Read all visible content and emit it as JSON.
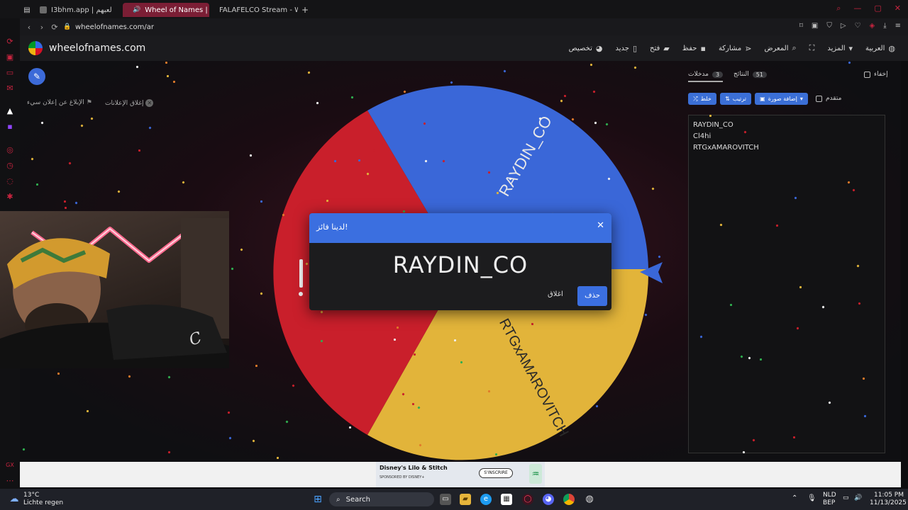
{
  "browser": {
    "tabs": [
      {
        "label": "I3bhm.app | لعبهم",
        "color": "#6b6b6b",
        "active": false
      },
      {
        "label": "Wheel of Names | عجلة",
        "color": "#e23b3b",
        "active": true
      },
      {
        "label": "FALAFELCO Stream - Wa",
        "color": "#53fc18",
        "active": false
      }
    ],
    "new_tab": "+",
    "url": "wheelofnames.com/ar"
  },
  "site": {
    "name": "wheelofnames.com",
    "menu": [
      {
        "label": "تخصيص",
        "icon": "palette-icon"
      },
      {
        "label": "جديد",
        "icon": "file-icon"
      },
      {
        "label": "فتح",
        "icon": "folder-icon"
      },
      {
        "label": "حفظ",
        "icon": "save-icon"
      },
      {
        "label": "مشاركة",
        "icon": "share-icon"
      },
      {
        "label": "المعرض",
        "icon": "search-icon"
      },
      {
        "label": "",
        "icon": "fullscreen-icon"
      },
      {
        "label": "المزيد",
        "icon": "caret-down-icon"
      },
      {
        "label": "العربية",
        "icon": "globe-icon"
      }
    ]
  },
  "ads": {
    "report_ad": "الإبلاغ عن إعلان سيء",
    "close_ads": "إغلاق الإعلانات"
  },
  "panel": {
    "hide_label": "إخفاء",
    "tab_entries": "مدخلات",
    "entries_count": "3",
    "tab_results": "النتائج",
    "results_count": "51",
    "btn_shuffle": "خلط",
    "btn_sort": "ترتيب",
    "btn_image": "إضافة صورة",
    "advanced": "متقدم",
    "entries": [
      "RAYDIN_CO",
      "Cl4hi",
      "RTGxAMAROVITCH"
    ]
  },
  "wheel": {
    "colors": [
      "#3a67d8",
      "#e2b43a",
      "#c91f2b"
    ],
    "labels": [
      "RAYDIN_CO",
      "RTGxAMAROVITCH"
    ]
  },
  "dialog": {
    "title": "لدينا فائز!",
    "winner": "RAYDIN_CO",
    "close_label": "اغلاق",
    "remove_label": "حذف"
  },
  "ad": {
    "title": "Disney's Lilo & Stitch",
    "sponsor": "SPONSORED BY DISNEY+",
    "cta": "S'INSCRIRE"
  },
  "taskbar": {
    "temp": "13°C",
    "weather": "Lichte regen",
    "search": "Search",
    "lang1": "NLD",
    "lang2": "BEP",
    "time": "11:05 PM",
    "date": "11/13/2025"
  }
}
